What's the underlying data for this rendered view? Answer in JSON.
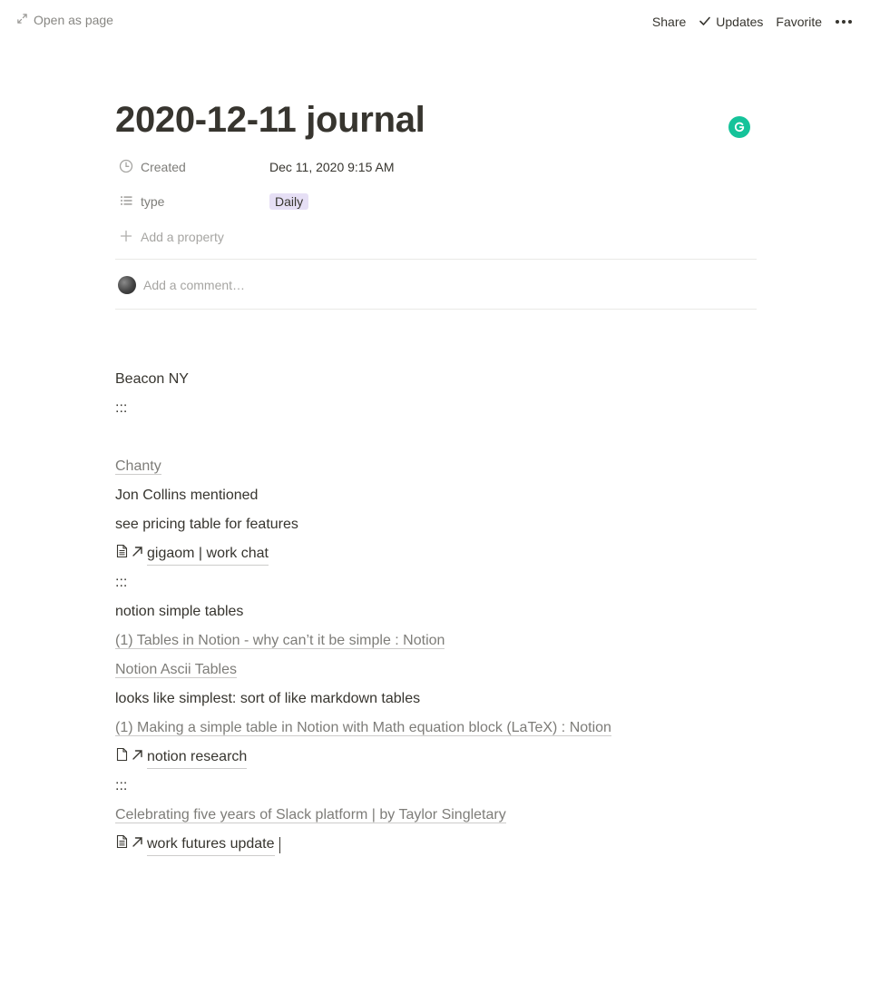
{
  "topbar": {
    "open_as_page": "Open as page",
    "share": "Share",
    "updates": "Updates",
    "favorite": "Favorite"
  },
  "page": {
    "title": "2020-12-11 journal",
    "properties": [
      {
        "name": "Created",
        "value": "Dec 11, 2020 9:15 AM",
        "icon": "clock-icon"
      },
      {
        "name": "type",
        "value": "Daily",
        "icon": "list-icon",
        "tag_color": "#e6dff5"
      }
    ],
    "add_property": "Add a property",
    "comment_placeholder": "Add a comment…"
  },
  "blocks": [
    {
      "kind": "text",
      "text": "Beacon NY"
    },
    {
      "kind": "text",
      "text": ":::"
    },
    {
      "kind": "link",
      "text": "Chanty"
    },
    {
      "kind": "text",
      "text": "Jon Collins mentioned"
    },
    {
      "kind": "text",
      "text": "see pricing table for features"
    },
    {
      "kind": "page-link",
      "text": "gigaom | work chat",
      "icon": "document-lines-icon"
    },
    {
      "kind": "text",
      "text": ":::"
    },
    {
      "kind": "text",
      "text": "notion simple tables"
    },
    {
      "kind": "link",
      "text": "(1) Tables in Notion - why can’t it be simple : Notion"
    },
    {
      "kind": "link",
      "text": "Notion Ascii Tables"
    },
    {
      "kind": "text",
      "text": "looks like simplest: sort of like markdown tables"
    },
    {
      "kind": "link",
      "text": "(1) Making a simple table in Notion with Math equation block (LaTeX) : Notion"
    },
    {
      "kind": "page-link",
      "text": "notion research",
      "icon": "document-blank-icon"
    },
    {
      "kind": "text",
      "text": ":::"
    },
    {
      "kind": "link",
      "text": "Celebrating five years of Slack platform | by Taylor Singletary"
    },
    {
      "kind": "page-link",
      "text": "work futures update",
      "icon": "document-lines-icon"
    }
  ],
  "colors": {
    "text": "#37352f",
    "grammarly": "#15c39a",
    "tag_purple": "#e6dff5"
  }
}
